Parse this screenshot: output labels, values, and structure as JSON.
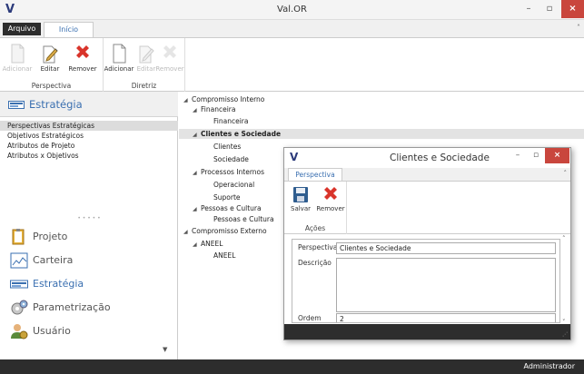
{
  "window": {
    "logo": "V",
    "title": "Val.OR",
    "minimize_icon": "minimize-icon",
    "maximize_icon": "maximize-icon",
    "close_icon": "close-icon"
  },
  "tabs": {
    "file": "Arquivo",
    "home": "Início"
  },
  "ribbon": {
    "perspectiva": {
      "label": "Perspectiva",
      "buttons": [
        {
          "label": "Adicionar",
          "enabled": false,
          "icon": "document-icon"
        },
        {
          "label": "Editar",
          "enabled": true,
          "icon": "edit-icon"
        },
        {
          "label": "Remover",
          "enabled": true,
          "icon": "remove-icon"
        }
      ]
    },
    "diretriz": {
      "label": "Diretriz",
      "buttons": [
        {
          "label": "Adicionar",
          "enabled": true,
          "icon": "document-icon"
        },
        {
          "label": "Editar",
          "enabled": false,
          "icon": "edit-icon"
        },
        {
          "label": "Remover",
          "enabled": false,
          "icon": "remove-icon"
        }
      ]
    }
  },
  "nav": {
    "section_title": "Estratégia",
    "sub_items": [
      {
        "label": "Perspectivas Estratégicas",
        "selected": true
      },
      {
        "label": "Objetivos Estratégicos",
        "selected": false
      },
      {
        "label": "Atributos de Projeto",
        "selected": false
      },
      {
        "label": "Atributos x Objetivos",
        "selected": false
      }
    ],
    "modules": [
      {
        "label": "Projeto",
        "icon": "project-icon",
        "active": false
      },
      {
        "label": "Carteira",
        "icon": "portfolio-icon",
        "active": false
      },
      {
        "label": "Estratégia",
        "icon": "strategy-icon",
        "active": true
      },
      {
        "label": "Parametrização",
        "icon": "settings-icon",
        "active": false
      },
      {
        "label": "Usuário",
        "icon": "user-icon",
        "active": false
      }
    ]
  },
  "tree": [
    {
      "label": "Compromisso Interno",
      "level": 0,
      "expanded": true,
      "selected": false
    },
    {
      "label": "Financeira",
      "level": 1,
      "expanded": true,
      "selected": false
    },
    {
      "label": "Financeira",
      "level": 2,
      "expanded": false,
      "selected": false
    },
    {
      "label": "Clientes e Sociedade",
      "level": 1,
      "expanded": true,
      "selected": true
    },
    {
      "label": "Clientes",
      "level": 2,
      "expanded": false,
      "selected": false
    },
    {
      "label": "Sociedade",
      "level": 2,
      "expanded": false,
      "selected": false
    },
    {
      "label": "Processos Internos",
      "level": 1,
      "expanded": true,
      "selected": false
    },
    {
      "label": "Operacional",
      "level": 2,
      "expanded": false,
      "selected": false
    },
    {
      "label": "Suporte",
      "level": 2,
      "expanded": false,
      "selected": false
    },
    {
      "label": "Pessoas e Cultura",
      "level": 1,
      "expanded": true,
      "selected": false
    },
    {
      "label": "Pessoas e Cultura",
      "level": 2,
      "expanded": false,
      "selected": false
    },
    {
      "label": "Compromisso Externo",
      "level": 0,
      "expanded": true,
      "selected": false
    },
    {
      "label": "ANEEL",
      "level": 1,
      "expanded": true,
      "selected": false
    },
    {
      "label": "ANEEL",
      "level": 2,
      "expanded": false,
      "selected": false
    }
  ],
  "status": {
    "user": "Administrador"
  },
  "dialog": {
    "logo": "V",
    "title": "Clientes e Sociedade",
    "tab": "Perspectiva",
    "group_label": "Ações",
    "save_label": "Salvar",
    "remove_label": "Remover",
    "fields": {
      "perspectiva_label": "Perspectiva",
      "perspectiva_value": "Clientes e Sociedade",
      "descricao_label": "Descrição",
      "descricao_value": "",
      "ordem_label": "Ordem",
      "ordem_value": "2"
    }
  },
  "colors": {
    "accent": "#3a6fb0",
    "close": "#c9463d",
    "dark_bar": "#2d2d2d",
    "remove_red": "#d9342b"
  }
}
